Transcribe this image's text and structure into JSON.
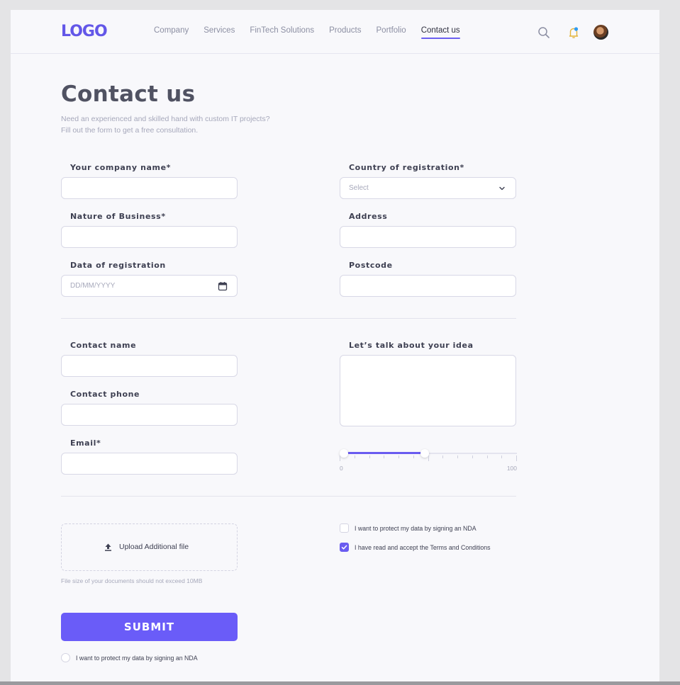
{
  "header": {
    "logo": "LOGO",
    "nav": [
      "Company",
      "Services",
      "FinTech Solutions",
      "Products",
      "Portfolio",
      "Contact us"
    ],
    "active_nav": "Contact us",
    "icons": [
      "search-icon",
      "bell-icon",
      "avatar"
    ]
  },
  "page": {
    "title": "Contact us",
    "subtitle_line1": "Need an experienced and skilled hand with custom IT projects?",
    "subtitle_line2": "Fill out the form to get a free consultation."
  },
  "form": {
    "company_name_label": "Your company name*",
    "country_label": "Country of registration*",
    "country_value": "Select",
    "nature_label": "Nature of Business*",
    "address_label": "Address",
    "date_label": "Data of registration",
    "date_placeholder": "DD/MM/YYYY",
    "postcode_label": "Postcode",
    "contact_name_label": "Contact name",
    "idea_label": "Let’s talk about your idea",
    "phone_label": "Contact phone",
    "email_label": "Email*",
    "slider_min": "0",
    "slider_max": "100",
    "slider_value": 48,
    "upload_label": "Upload Additional file",
    "upload_note": "File size of your documents should not exceed 10MB",
    "nda_checkbox": "I want to protect my data by signing an NDA",
    "terms_checkbox": "I have read and accept the Terms and Conditions",
    "submit_label": "SUBMIT",
    "nda_radio": "I want to protect my data by signing an NDA"
  },
  "colors": {
    "accent": "#6a5cf8",
    "background": "#f8f8fb"
  }
}
